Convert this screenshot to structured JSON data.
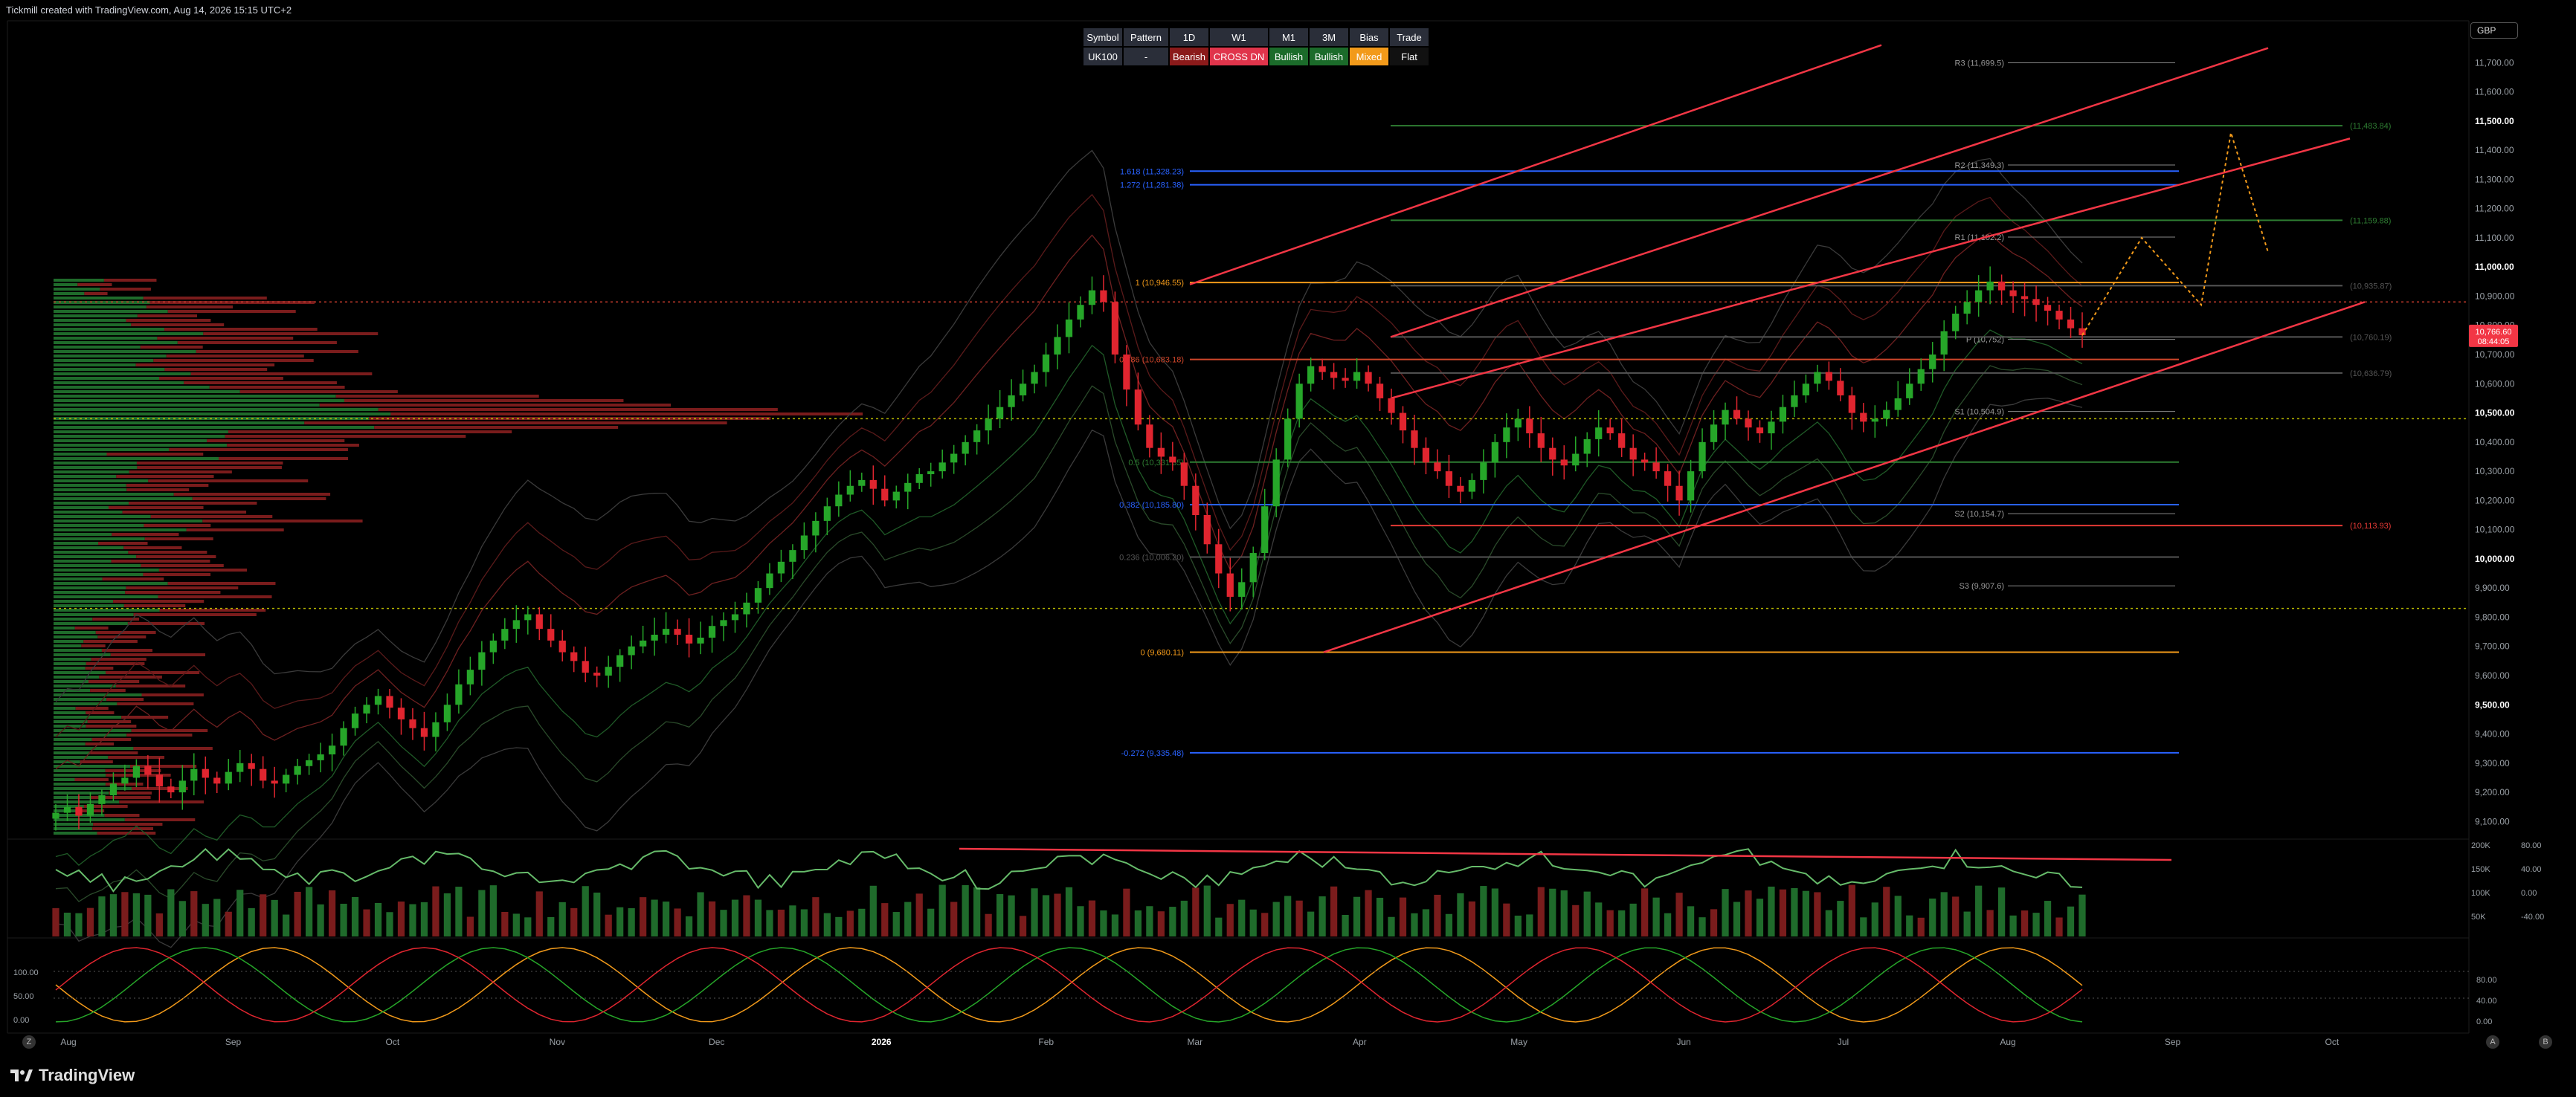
{
  "header": {
    "text": "Tickmill created with TradingView.com, Aug 14, 2026 15:15 UTC+2"
  },
  "currency_button": {
    "label": "GBP"
  },
  "brand": {
    "name": "TradingView"
  },
  "signal_table": {
    "headers": [
      "Symbol",
      "Pattern",
      "1D",
      "W1",
      "M1",
      "3M",
      "Bias",
      "Trade"
    ],
    "values": [
      "UK100",
      "-",
      "Bearish",
      "CROSS DN",
      "Bullish",
      "Bullish",
      "Mixed",
      "Flat"
    ],
    "value_colors": [
      "#2a2e39",
      "#2a2e39",
      "#8b1a1a",
      "#e0344b",
      "#1b6b2a",
      "#1b6b2a",
      "#f29a1a",
      "#111111"
    ]
  },
  "footer_icons": [
    "Z",
    "A",
    "B"
  ],
  "chart_data": [
    {
      "type": "candlestick",
      "symbol": "UK100",
      "currency": "GBP",
      "y_range": [
        9050,
        11800
      ],
      "y_ticks": [
        "11,700.00",
        "11,600.00",
        "11,500.00",
        "11,400.00",
        "11,300.00",
        "11,200.00",
        "11,100.00",
        "11,000.00",
        "10,900.00",
        "10,800.00",
        "10,700.00",
        "10,600.00",
        "10,500.00",
        "10,400.00",
        "10,300.00",
        "10,200.00",
        "10,100.00",
        "10,000.00",
        "9,900.00",
        "9,800.00",
        "9,700.00",
        "9,600.00",
        "9,500.00",
        "9,400.00",
        "9,300.00",
        "9,200.00",
        "9,100.00"
      ],
      "y_tick_values": [
        11700,
        11600,
        11500,
        11400,
        11300,
        11200,
        11100,
        11000,
        10900,
        10800,
        10700,
        10600,
        10500,
        10400,
        10300,
        10200,
        10100,
        10000,
        9900,
        9800,
        9700,
        9600,
        9500,
        9400,
        9300,
        9200,
        9100
      ],
      "bold_ticks": [
        11500,
        11000,
        10500,
        10000,
        9500
      ],
      "x_labels": [
        "Aug",
        "Sep",
        "Oct",
        "Nov",
        "Dec",
        "2026",
        "Feb",
        "Mar",
        "Apr",
        "May",
        "Jun",
        "Jul",
        "Aug",
        "Sep",
        "Oct"
      ],
      "x_label_days": [
        0,
        31,
        61,
        92,
        122,
        153,
        184,
        212,
        243,
        273,
        304,
        334,
        365,
        396,
        426
      ],
      "last_price_label": "10,766.60",
      "last_price_countdown": "08:44:05",
      "last_price": 10766.6,
      "fibonacci_levels": [
        {
          "label": "1.618 (11,328.23)",
          "value": 11328.23,
          "color": "#2962ff"
        },
        {
          "label": "1.272 (11,281.38)",
          "value": 11281.38,
          "color": "#2962ff"
        },
        {
          "label": "1 (10,946.55)",
          "value": 10946.55,
          "color": "#f29a1a"
        },
        {
          "label": "0.786 (10,683.18)",
          "value": 10683.18,
          "color": "#d0462a"
        },
        {
          "label": "0.5 (10,331.35)",
          "value": 10331.35,
          "color": "#2e7d32"
        },
        {
          "label": "0.382 (10,185.80)",
          "value": 10185.8,
          "color": "#2962ff"
        },
        {
          "label": "0.236 (10,006.20)",
          "value": 10006.2,
          "color": "#555555"
        },
        {
          "label": "0 (9,680.11)",
          "value": 9680.11,
          "color": "#f29a1a"
        },
        {
          "label": "-0.272 (9,335.48)",
          "value": 9335.48,
          "color": "#2962ff"
        }
      ],
      "pivot_levels": [
        {
          "label": "R3 (11,699.5)",
          "value": 11699.5
        },
        {
          "label": "R2 (11,349.3)",
          "value": 11349.3
        },
        {
          "label": "R1 (11,102.2)",
          "value": 11102.2
        },
        {
          "label": "P (10,752)",
          "value": 10752
        },
        {
          "label": "S1 (10,504.9)",
          "value": 10504.9
        },
        {
          "label": "S2 (10,154.7)",
          "value": 10154.7
        },
        {
          "label": "S3 (9,907.6)",
          "value": 9907.6
        }
      ],
      "target_levels": [
        {
          "label": "(11,483.84)",
          "value": 11483.84,
          "color": "#2e7d32"
        },
        {
          "label": "(11,159.88)",
          "value": 11159.88,
          "color": "#2e7d32"
        },
        {
          "label": "(10,935.87)",
          "value": 10935.87,
          "color": "#555555"
        },
        {
          "label": "(10,760.19)",
          "value": 10760.19,
          "color": "#555555"
        },
        {
          "label": "(10,636.79)",
          "value": 10636.79,
          "color": "#555555"
        },
        {
          "label": "(10,113.93)",
          "value": 10113.93,
          "color": "#e53935"
        }
      ],
      "dotted_levels": [
        10880,
        10480,
        9830
      ],
      "closes": [
        9130,
        9150,
        9120,
        9160,
        9190,
        9230,
        9250,
        9290,
        9260,
        9220,
        9200,
        9240,
        9280,
        9250,
        9230,
        9270,
        9300,
        9280,
        9240,
        9230,
        9260,
        9290,
        9310,
        9330,
        9360,
        9420,
        9470,
        9500,
        9530,
        9490,
        9450,
        9420,
        9390,
        9440,
        9500,
        9570,
        9620,
        9680,
        9720,
        9760,
        9790,
        9810,
        9760,
        9720,
        9680,
        9650,
        9610,
        9600,
        9630,
        9670,
        9700,
        9720,
        9740,
        9760,
        9740,
        9710,
        9730,
        9770,
        9790,
        9810,
        9850,
        9900,
        9950,
        9990,
        10030,
        10080,
        10130,
        10180,
        10220,
        10250,
        10270,
        10240,
        10200,
        10230,
        10260,
        10290,
        10300,
        10330,
        10360,
        10400,
        10440,
        10480,
        10520,
        10560,
        10600,
        10640,
        10700,
        10760,
        10820,
        10870,
        10920,
        10880,
        10700,
        10580,
        10460,
        10380,
        10350,
        10330,
        10250,
        10150,
        10050,
        9950,
        9870,
        9920,
        10020,
        10180,
        10340,
        10480,
        10600,
        10660,
        10640,
        10620,
        10610,
        10640,
        10600,
        10550,
        10500,
        10440,
        10380,
        10330,
        10300,
        10250,
        10230,
        10270,
        10330,
        10400,
        10450,
        10480,
        10430,
        10380,
        10340,
        10320,
        10360,
        10410,
        10450,
        10430,
        10380,
        10340,
        10330,
        10300,
        10250,
        10200,
        10300,
        10400,
        10460,
        10510,
        10480,
        10450,
        10430,
        10470,
        10520,
        10560,
        10600,
        10640,
        10610,
        10560,
        10500,
        10470,
        10480,
        10510,
        10550,
        10600,
        10650,
        10700,
        10780,
        10840,
        10880,
        10920,
        10950,
        10920,
        10900,
        10890,
        10870,
        10850,
        10820,
        10790,
        10766
      ]
    },
    {
      "type": "volume-oscillator",
      "right_ticks": [
        "200K",
        "150K",
        "100K",
        "50K"
      ],
      "osc_ticks": [
        "80.00",
        "40.00",
        "0.00",
        "-40.00"
      ]
    },
    {
      "type": "stochastic",
      "left_ticks": [
        "100.00",
        "50.00",
        "0.00"
      ],
      "right_ticks": [
        "80.00",
        "40.00",
        "0.00"
      ]
    }
  ]
}
